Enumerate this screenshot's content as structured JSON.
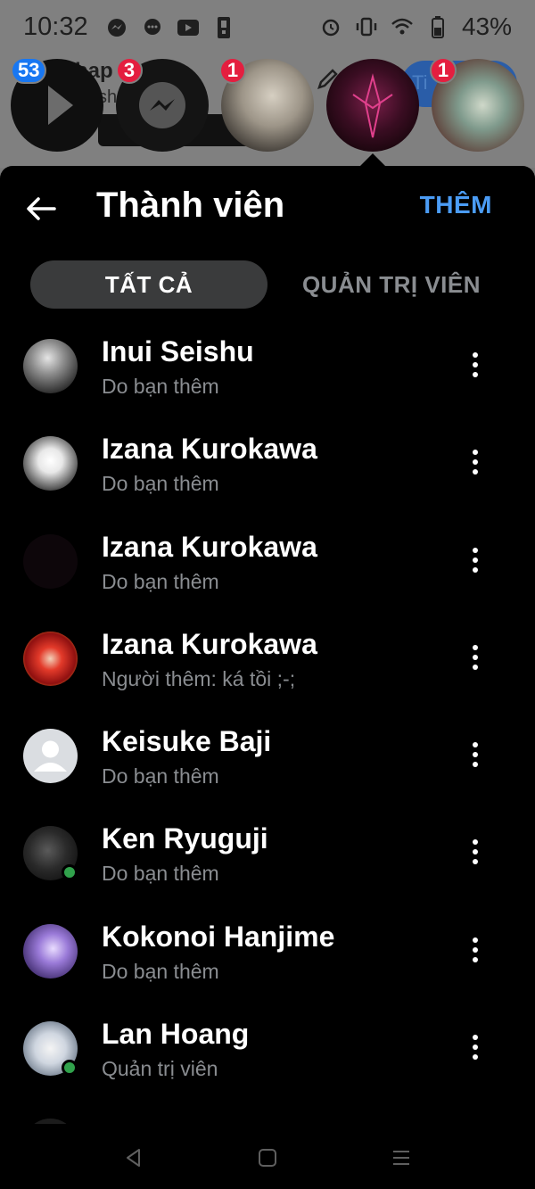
{
  "status_bar": {
    "time": "10:32",
    "battery": "43%",
    "left_icons": [
      "messenger-icon",
      "chat-bubble-icon",
      "youtube-icon",
      "sim-icon"
    ],
    "right_icons": [
      "alarm-icon",
      "vibrate-icon",
      "wifi-icon",
      "battery-icon"
    ]
  },
  "chat_heads": {
    "partial_text_1": "hap",
    "partial_text_2": "sh",
    "partial_button": "Ti",
    "items": [
      {
        "name": "media-play-head",
        "badge": "53",
        "badge_color": "#1877f2"
      },
      {
        "name": "messenger-head",
        "badge": "3",
        "badge_color": "#e41e3f"
      },
      {
        "name": "anime-avatar-head",
        "badge": "1",
        "badge_color": "#e41e3f"
      },
      {
        "name": "dark-pink-avatar-head",
        "badge": "",
        "badge_color": ""
      },
      {
        "name": "crystal-avatar-head",
        "badge": "1",
        "badge_color": "#e41e3f"
      }
    ]
  },
  "header": {
    "title": "Thành viên",
    "add_label": "THÊM"
  },
  "tabs": {
    "all": "TẤT CẢ",
    "admins": "QUẢN TRỊ VIÊN"
  },
  "members": [
    {
      "name": "Inui Seishu",
      "subtitle": "Do bạn thêm",
      "online": false,
      "avatar": "manga-bw"
    },
    {
      "name": "Izana Kurokawa",
      "subtitle": "Do bạn thêm",
      "online": false,
      "avatar": "manga-white"
    },
    {
      "name": "Izana Kurokawa",
      "subtitle": "Do bạn thêm",
      "online": false,
      "avatar": "dark"
    },
    {
      "name": "Izana Kurokawa",
      "subtitle": "Người thêm: ká tồi ;-;",
      "online": false,
      "avatar": "red"
    },
    {
      "name": "Keisuke Baji",
      "subtitle": "Do bạn thêm",
      "online": false,
      "avatar": "default"
    },
    {
      "name": "Ken Ryuguji",
      "subtitle": "Do bạn thêm",
      "online": true,
      "avatar": "dark-gray"
    },
    {
      "name": "Kokonoi Hanjime",
      "subtitle": "Do bạn thêm",
      "online": false,
      "avatar": "purple"
    },
    {
      "name": "Lan Hoang",
      "subtitle": "Quản trị viên",
      "online": true,
      "avatar": "light"
    }
  ],
  "colors": {
    "accent": "#4b9cf5",
    "online": "#31a24c",
    "badge_red": "#e41e3f",
    "badge_blue": "#1877f2",
    "sheet_bg": "#000000",
    "tab_active_bg": "#3a3b3c"
  },
  "nav": [
    "back-nav-icon",
    "home-nav-icon",
    "recents-nav-icon"
  ]
}
